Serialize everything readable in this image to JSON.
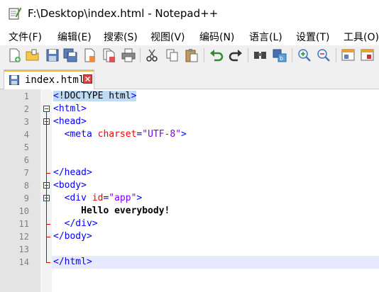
{
  "window": {
    "title": "F:\\Desktop\\index.html - Notepad++"
  },
  "menu": {
    "items": [
      "文件(F)",
      "编辑(E)",
      "搜索(S)",
      "视图(V)",
      "编码(N)",
      "语言(L)",
      "设置(T)",
      "工具(O)"
    ]
  },
  "toolbar": {
    "icons": [
      "new-file-icon",
      "open-file-icon",
      "save-icon",
      "save-all-icon",
      "close-icon",
      "close-all-icon",
      "print-icon",
      "cut-icon",
      "copy-icon",
      "paste-icon",
      "undo-icon",
      "redo-icon",
      "find-icon",
      "replace-icon",
      "zoom-in-icon",
      "zoom-out-icon",
      "sync-vertical-icon",
      "sync-horizontal-icon"
    ]
  },
  "tabs": [
    {
      "label": "index.html",
      "active": true
    }
  ],
  "editor": {
    "current_line": 14,
    "lines": [
      {
        "n": "1",
        "code": "<!DOCTYPE html>"
      },
      {
        "n": "2",
        "code": "<html>"
      },
      {
        "n": "3",
        "code": "<head>"
      },
      {
        "n": "4",
        "code": "  <meta charset=\"UTF-8\">"
      },
      {
        "n": "5",
        "code": ""
      },
      {
        "n": "6",
        "code": ""
      },
      {
        "n": "7",
        "code": "</head>"
      },
      {
        "n": "8",
        "code": "<body>"
      },
      {
        "n": "9",
        "code": "  <div id=\"app\">"
      },
      {
        "n": "10",
        "code": "     Hello everybody!"
      },
      {
        "n": "11",
        "code": "  </div>"
      },
      {
        "n": "12",
        "code": "</body>"
      },
      {
        "n": "13",
        "code": ""
      },
      {
        "n": "14",
        "code": "</html>"
      }
    ]
  },
  "colors": {
    "tag": "#0000ff",
    "attribute": "#ff0000",
    "value": "#8000ff",
    "fold_marker": "#d00000",
    "current_line_bg": "#e8e8ff",
    "tab_accent": "#f5b733"
  }
}
